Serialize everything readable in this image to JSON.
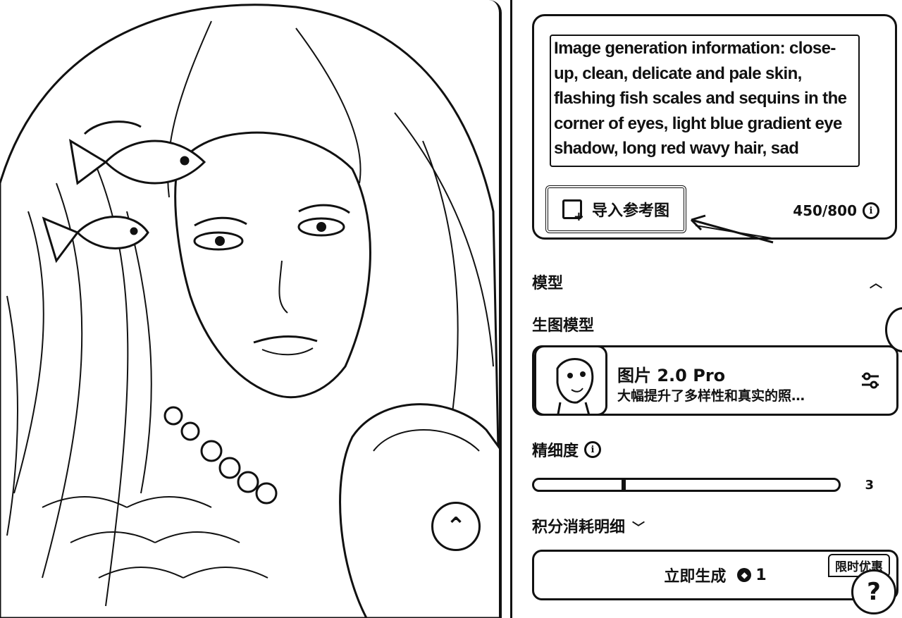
{
  "prompt": {
    "text": "Image generation information: close-up, clean, delicate and pale skin, flashing fish scales and sequins in the corner of eyes, light blue gradient eye shadow, long red wavy hair, sad expression, skin",
    "import_label": "导入参考图",
    "counter": "450/800"
  },
  "model_section": {
    "title": "模型",
    "subtitle": "生图模型",
    "model_name": "图片 2.0 Pro",
    "model_desc": "大幅提升了多样性和真实的照…"
  },
  "detail": {
    "label": "精细度",
    "value_fraction": 0.3,
    "value_text": "3"
  },
  "cost": {
    "label": "积分消耗明细"
  },
  "generate": {
    "label": "立即生成",
    "credits": "1",
    "promo": "限时优惠"
  },
  "help": {
    "label": "?"
  },
  "icons": {
    "import": "add-image-icon",
    "info": "info-icon",
    "chevron_up": "chevron-up-icon",
    "chevron_down": "chevron-down-icon",
    "settings": "sliders-icon",
    "credit": "credit-coin-icon",
    "collapse": "chevron-up-icon"
  }
}
